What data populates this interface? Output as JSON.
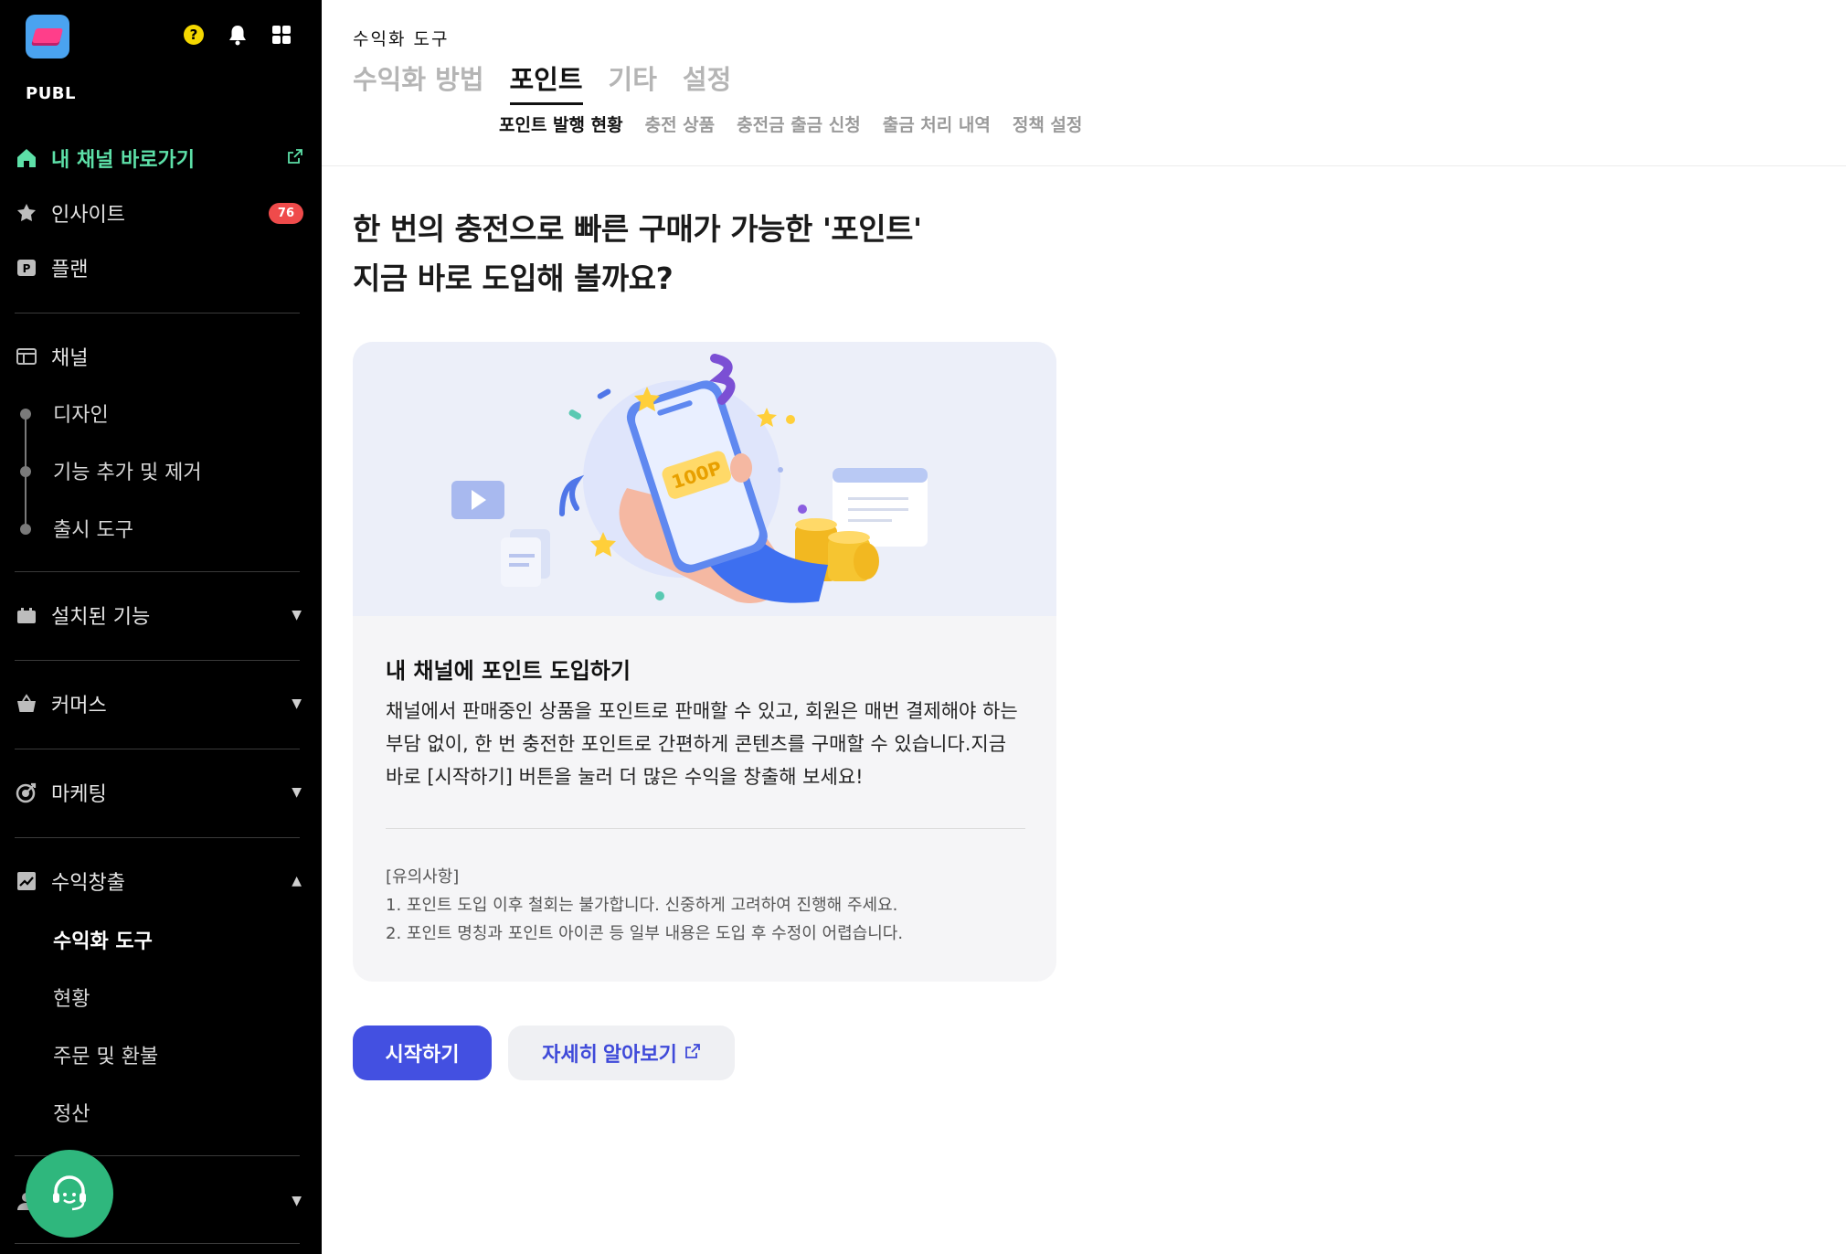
{
  "sidebar": {
    "brand": "PUBL",
    "home_label": "내 채널 바로가기",
    "insight_label": "인사이트",
    "insight_badge": "76",
    "plan_label": "플랜",
    "channel_label": "채널",
    "channel_sub": [
      "디자인",
      "기능 추가 및 제거",
      "출시 도구"
    ],
    "installed_label": "설치된 기능",
    "commerce_label": "커머스",
    "marketing_label": "마케팅",
    "revenue_label": "수익창출",
    "revenue_sub": [
      "수익화 도구",
      "현황",
      "주문 및 환불",
      "정산"
    ]
  },
  "header": {
    "breadcrumb": "수익화 도구",
    "tabs": [
      "수익화 방법",
      "포인트",
      "기타",
      "설정"
    ],
    "subtabs": [
      "포인트 발행 현황",
      "충전 상품",
      "충전금 출금 신청",
      "출금 처리 내역",
      "정책 설정"
    ]
  },
  "main": {
    "headline_line1": "한 번의 충전으로 빠른 구매가 가능한 '포인트'",
    "headline_line2": "지금 바로 도입해 볼까요?",
    "card_title": "내 채널에 포인트 도입하기",
    "card_body": "채널에서 판매중인 상품을 포인트로 판매할 수 있고, 회원은 매번 결제해야 하는 부담 없이, 한 번 충전한 포인트로 간편하게 콘텐츠를 구매할 수 있습니다.지금 바로 [시작하기] 버튼을 눌러 더 많은 수익을 창출해 보세요!",
    "notes_title": "[유의사항]",
    "note_1": "1. 포인트 도입 이후 철회는 불가합니다. 신중하게 고려하여 진행해 주세요.",
    "note_2": "2. 포인트 명칭과 포인트 아이콘 등 일부 내용은 도입 후 수정이 어렵습니다.",
    "hero_point_text": "100P",
    "start_button": "시작하기",
    "learn_more_button": "자세히 알아보기"
  },
  "colors": {
    "accent": "#4350e1",
    "home_green": "#5de0a8",
    "badge_red": "#ef4b4b",
    "fab_green": "#2fb77d"
  }
}
